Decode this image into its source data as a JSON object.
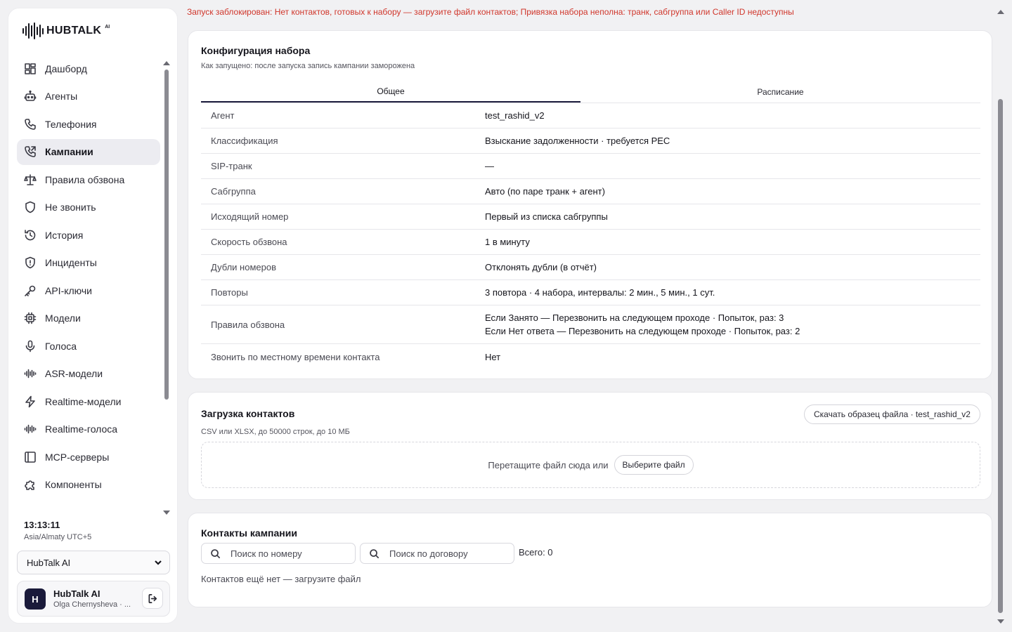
{
  "app": {
    "logo_text": "HUBTALK",
    "logo_sup": "AI"
  },
  "sidebar": {
    "items": [
      {
        "label": "Дашборд",
        "icon": "dashboard-icon"
      },
      {
        "label": "Агенты",
        "icon": "robot-icon"
      },
      {
        "label": "Телефония",
        "icon": "phone-icon"
      },
      {
        "label": "Кампании",
        "icon": "phone-outgoing-icon",
        "active": true
      },
      {
        "label": "Правила обзвона",
        "icon": "scale-icon"
      },
      {
        "label": "Не звонить",
        "icon": "shield-icon"
      },
      {
        "label": "История",
        "icon": "history-icon"
      },
      {
        "label": "Инциденты",
        "icon": "shield-alert-icon"
      },
      {
        "label": "API-ключи",
        "icon": "key-icon"
      },
      {
        "label": "Модели",
        "icon": "cpu-icon"
      },
      {
        "label": "Голоса",
        "icon": "mic-icon"
      },
      {
        "label": "ASR-модели",
        "icon": "waveform-icon"
      },
      {
        "label": "Realtime-модели",
        "icon": "lightning-icon"
      },
      {
        "label": "Realtime-голоса",
        "icon": "waveform-icon"
      },
      {
        "label": "MCP-серверы",
        "icon": "panel-icon"
      },
      {
        "label": "Компоненты",
        "icon": "puzzle-icon"
      }
    ],
    "clock": "13:13:11",
    "timezone": "Asia/Almaty UTC+5",
    "org_select": "HubTalk AI",
    "user": {
      "avatar_letter": "H",
      "name": "HubTalk AI",
      "subtitle": "Olga Chernysheva · ..."
    }
  },
  "alert": "Запуск заблокирован: Нет контактов, готовых к набору — загрузите файл контактов; Привязка набора неполна: транк, сабгруппа или Caller ID недоступны",
  "config": {
    "title": "Конфигурация набора",
    "subtitle": "Как запущено: после запуска запись кампании заморожена",
    "tabs": [
      {
        "label": "Общее",
        "active": true
      },
      {
        "label": "Расписание"
      }
    ],
    "rows": [
      {
        "key": "Агент",
        "value": "test_rashid_v2"
      },
      {
        "key": "Классификация",
        "value": "Взыскание задолженности · требуется PEC"
      },
      {
        "key": "SIP-транк",
        "value": "—"
      },
      {
        "key": "Сабгруппа",
        "value": "Авто (по паре транк + агент)"
      },
      {
        "key": "Исходящий номер",
        "value": "Первый из списка сабгруппы"
      },
      {
        "key": "Скорость обзвона",
        "value": "1 в минуту"
      },
      {
        "key": "Дубли номеров",
        "value": "Отклонять дубли (в отчёт)"
      },
      {
        "key": "Повторы",
        "value": "3 повтора · 4 набора, интервалы: 2 мин., 5 мин., 1 сут."
      },
      {
        "key": "Правила обзвона",
        "value": "Если Занято — Перезвонить на следующем проходе · Попыток, раз: 3",
        "value2": "Если Нет ответа — Перезвонить на следующем проходе · Попыток, раз: 2"
      },
      {
        "key": "Звонить по местному времени контакта",
        "value": "Нет"
      }
    ]
  },
  "upload": {
    "title": "Загрузка контактов",
    "subtitle": "CSV или XLSX, до 50000 строк, до 10 МБ",
    "sample_button": "Скачать образец файла · test_rashid_v2",
    "drop_text": "Перетащите файл сюда или",
    "choose_button": "Выберите файл"
  },
  "contacts": {
    "title": "Контакты кампании",
    "search_phone_placeholder": "Поиск по номеру",
    "search_contract_placeholder": "Поиск по договору",
    "total": "Всего: 0",
    "empty": "Контактов ещё нет — загрузите файл"
  }
}
